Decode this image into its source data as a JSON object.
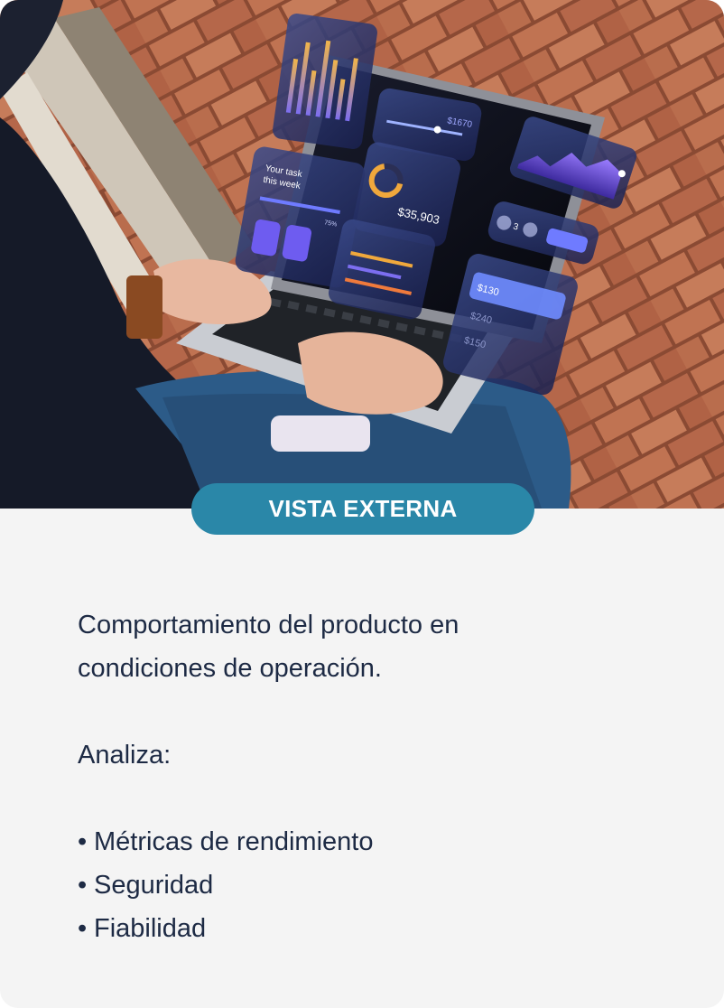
{
  "badge": {
    "label": "VISTA EXTERNA"
  },
  "description": {
    "line1": "Comportamiento del producto en",
    "line2": "condiciones de operación."
  },
  "analysis": {
    "heading": "Analiza:",
    "items": [
      "Métricas de rendimiento",
      "Seguridad",
      "Fiabilidad"
    ]
  },
  "hero_ui": {
    "task_card_title_1": "Your task",
    "task_card_title_2": "this week",
    "task_progress": "75%",
    "balance_amount": "$35,903",
    "price_tag": "$1670",
    "transaction_1": "$130",
    "transaction_2": "$240",
    "transaction_3": "$150",
    "stepper_value": "3"
  },
  "colors": {
    "accent": "#2a87a8",
    "text": "#1d2a44",
    "panel": "#f4f4f4"
  }
}
